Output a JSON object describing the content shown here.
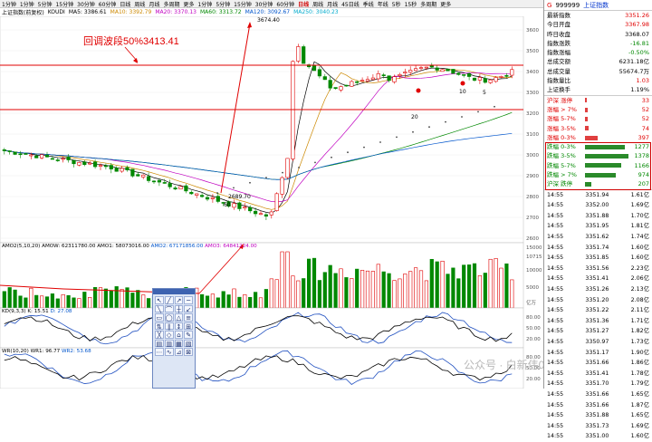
{
  "toolbar": {
    "tabs": [
      "1分钟",
      "1分钟",
      "5分钟",
      "15分钟",
      "30分钟",
      "60分钟",
      "日线",
      "周线",
      "月线",
      "多周期",
      "更多",
      "1分钟",
      "5分钟",
      "15分钟",
      "30分钟",
      "60分钟",
      "日线",
      "周线",
      "月线",
      "45日线",
      "季线",
      "年线",
      "5秒",
      "15秒",
      "多周期",
      "更多"
    ],
    "active_tab": "日线"
  },
  "infobar": {
    "index_name": "上证指数(前复权)",
    "indicator": "KOUDI",
    "ma5": "MA5: 3386.61",
    "ma10": "MA10: 3392.79",
    "ma20": "MA20: 3370.13",
    "ma60": "MA60: 3313.72",
    "ma120": "MA120: 3092.67",
    "ma250": "MA250: 3040.23"
  },
  "annotation": {
    "text": "回调波段50%3413.41",
    "high_label": "3674.40",
    "low_label": "2689.70",
    "low_sub": "60",
    "mark_20": "20",
    "mark_10": "10",
    "mark_5": "5"
  },
  "price_axis": [
    "3600",
    "3500",
    "3400",
    "3300",
    "3200",
    "3100",
    "3000",
    "2900",
    "2800",
    "2700",
    "2600"
  ],
  "volume_header": {
    "ama": "AMO2(5,10,20)",
    "amow": "AMOW: 62311780.00",
    "amo1": "AMO1: 58073016.00",
    "amo2": "AMO2: 67171856.00",
    "amo3": "AMO3: 64841224.00"
  },
  "volume_axis": [
    "15000",
    "10715",
    "10000",
    "5000",
    "亿万"
  ],
  "kdj_header": {
    "name": "KD(9,3,3)",
    "k": "K: 15.51",
    "d": "D: 27.08"
  },
  "kdj_axis": [
    "80.00",
    "50.00",
    "20.00"
  ],
  "wr_header": {
    "name": "WR(10,20)",
    "wr1": "WR1: 96.77",
    "wr2": "WR2: 53.68"
  },
  "wr_axis": [
    "80.00",
    "50.00",
    "20.00"
  ],
  "watermark": "公众号 · 白新伟0",
  "side": {
    "header": {
      "code": "999999",
      "name": "上证指数",
      "flag": "G"
    },
    "quotes": [
      {
        "label": "最新指数",
        "value": "3351.26",
        "cls": "red"
      },
      {
        "label": "今日开盘",
        "value": "3367.98",
        "cls": "red"
      },
      {
        "label": "昨日收盘",
        "value": "3368.07",
        "cls": ""
      },
      {
        "label": "指数涨跌",
        "value": "-16.81",
        "cls": "green"
      },
      {
        "label": "指数涨幅",
        "value": "-0.50%",
        "cls": "green"
      },
      {
        "label": "总成交额",
        "value": "6231.18亿",
        "cls": ""
      },
      {
        "label": "总成交量",
        "value": "55674.7万",
        "cls": ""
      },
      {
        "label": "指数量比",
        "value": "1.03",
        "cls": "red"
      },
      {
        "label": "上证换手",
        "value": "1.19%",
        "cls": ""
      }
    ],
    "breadth": [
      {
        "label": "沪深 涨停",
        "value": "33",
        "frac": 0.05,
        "cls": "red"
      },
      {
        "label": "涨幅 > 7%",
        "value": "52",
        "frac": 0.06,
        "cls": "red"
      },
      {
        "label": "涨幅 5-7%",
        "value": "52",
        "frac": 0.06,
        "cls": "red"
      },
      {
        "label": "涨幅 3-5%",
        "value": "74",
        "frac": 0.08,
        "cls": "red"
      },
      {
        "label": "涨幅 0-3%",
        "value": "397",
        "frac": 0.28,
        "cls": "red"
      },
      {
        "label": "跌幅 0-3%",
        "value": "1277",
        "frac": 0.9,
        "cls": "green"
      },
      {
        "label": "跌幅 3-5%",
        "value": "1378",
        "frac": 0.97,
        "cls": "green"
      },
      {
        "label": "跌幅 5-7%",
        "value": "1166",
        "frac": 0.82,
        "cls": "green"
      },
      {
        "label": "跌幅 > 7%",
        "value": "974",
        "frac": 0.69,
        "cls": "green"
      },
      {
        "label": "沪深 跌停",
        "value": "207",
        "frac": 0.15,
        "cls": "green"
      }
    ],
    "ticks": [
      {
        "t": "14:55",
        "p": "3351.94",
        "v": "1.61亿"
      },
      {
        "t": "14:55",
        "p": "3352.00",
        "v": "1.69亿"
      },
      {
        "t": "14:55",
        "p": "3351.88",
        "v": "1.70亿"
      },
      {
        "t": "14:55",
        "p": "3351.95",
        "v": "1.81亿"
      },
      {
        "t": "14:55",
        "p": "3351.62",
        "v": "1.74亿"
      },
      {
        "t": "14:55",
        "p": "3351.74",
        "v": "1.60亿"
      },
      {
        "t": "14:55",
        "p": "3351.85",
        "v": "1.60亿"
      },
      {
        "t": "14:55",
        "p": "3351.56",
        "v": "2.23亿"
      },
      {
        "t": "14:55",
        "p": "3351.41",
        "v": "2.06亿"
      },
      {
        "t": "14:55",
        "p": "3351.26",
        "v": "2.13亿"
      },
      {
        "t": "14:55",
        "p": "3351.20",
        "v": "2.08亿"
      },
      {
        "t": "14:55",
        "p": "3351.22",
        "v": "2.11亿"
      },
      {
        "t": "14:55",
        "p": "3351.36",
        "v": "1.71亿"
      },
      {
        "t": "14:55",
        "p": "3351.27",
        "v": "1.82亿"
      },
      {
        "t": "14:55",
        "p": "3350.97",
        "v": "1.73亿"
      },
      {
        "t": "14:55",
        "p": "3351.17",
        "v": "1.90亿"
      },
      {
        "t": "14:55",
        "p": "3351.66",
        "v": "1.86亿"
      },
      {
        "t": "14:55",
        "p": "3351.41",
        "v": "1.78亿"
      },
      {
        "t": "14:55",
        "p": "3351.70",
        "v": "1.79亿"
      },
      {
        "t": "14:55",
        "p": "3351.66",
        "v": "1.65亿"
      },
      {
        "t": "14:55",
        "p": "3351.66",
        "v": "1.87亿"
      },
      {
        "t": "14:55",
        "p": "3351.88",
        "v": "1.65亿"
      },
      {
        "t": "14:55",
        "p": "3351.73",
        "v": "1.69亿"
      },
      {
        "t": "14:55",
        "p": "3351.00",
        "v": "1.60亿"
      }
    ]
  },
  "colors": {
    "up": "#e00000",
    "down": "#008800",
    "accent_box": "#d00000"
  }
}
